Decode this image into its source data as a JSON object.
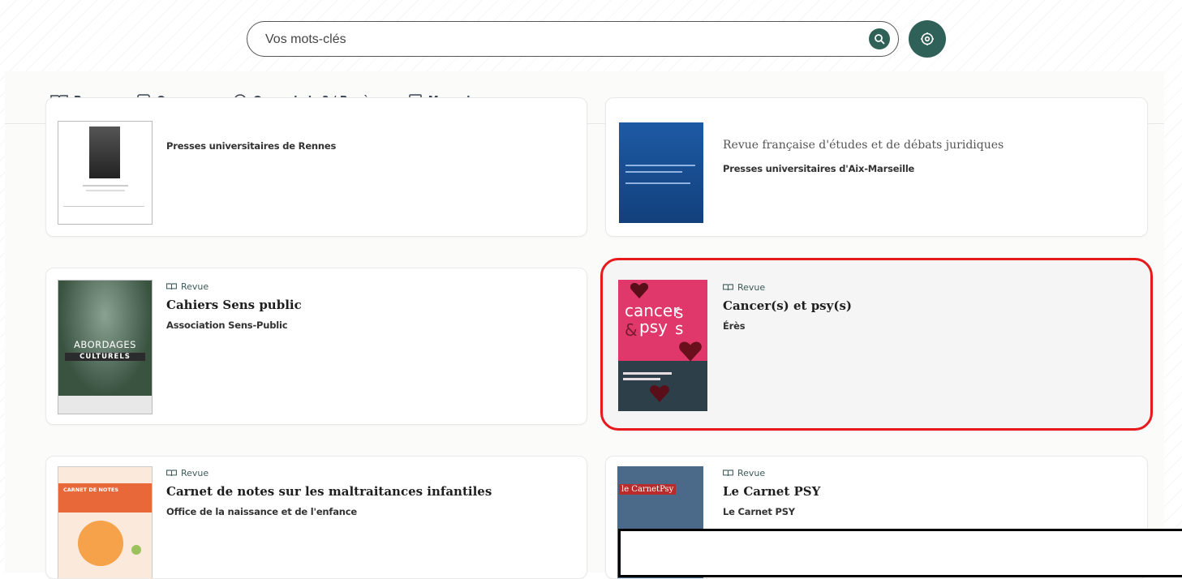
{
  "colors": {
    "accent": "#2f6158",
    "highlight": "#e8191c"
  },
  "search": {
    "placeholder": "Vos mots-clés",
    "value": "",
    "search_icon": "search-icon",
    "settings_icon": "gear-icon"
  },
  "tabs": [
    {
      "label": "Revues",
      "icon": "book-open-icon",
      "active": true
    },
    {
      "label": "Ouvrages",
      "icon": "book-icon",
      "active": false
    },
    {
      "label": "Que sais-je ? / Repères",
      "icon": "compass-icon",
      "active": false
    },
    {
      "label": "Magazines",
      "icon": "newspaper-icon",
      "active": false
    }
  ],
  "cards": [
    {
      "type": "",
      "title": "",
      "subtitle": "",
      "publisher": "Presses universitaires de Rennes"
    },
    {
      "type": "",
      "title": "",
      "subtitle": "Revue française d'études et de débats juridiques",
      "publisher": "Presses universitaires d'Aix-Marseille"
    },
    {
      "type": "Revue",
      "title": "Cahiers Sens public",
      "publisher": "Association Sens-Public",
      "cover_text": [
        "ABORDAGES",
        "CULTURELS"
      ]
    },
    {
      "type": "Revue",
      "title": "Cancer(s) et psy(s)",
      "publisher": "Érès",
      "highlighted": true,
      "cover_text": [
        "cancer",
        "&",
        "psy",
        "s",
        "s"
      ]
    },
    {
      "type": "Revue",
      "title": "Carnet de notes sur les maltraitances infantiles",
      "publisher": "Office de la naissance et de l'enfance",
      "cover_text": [
        "CARNET DE NOTES"
      ]
    },
    {
      "type": "Revue",
      "title": "Le Carnet PSY",
      "publisher": "Le Carnet PSY",
      "cover_text": [
        "le CarnetPsy"
      ]
    }
  ]
}
